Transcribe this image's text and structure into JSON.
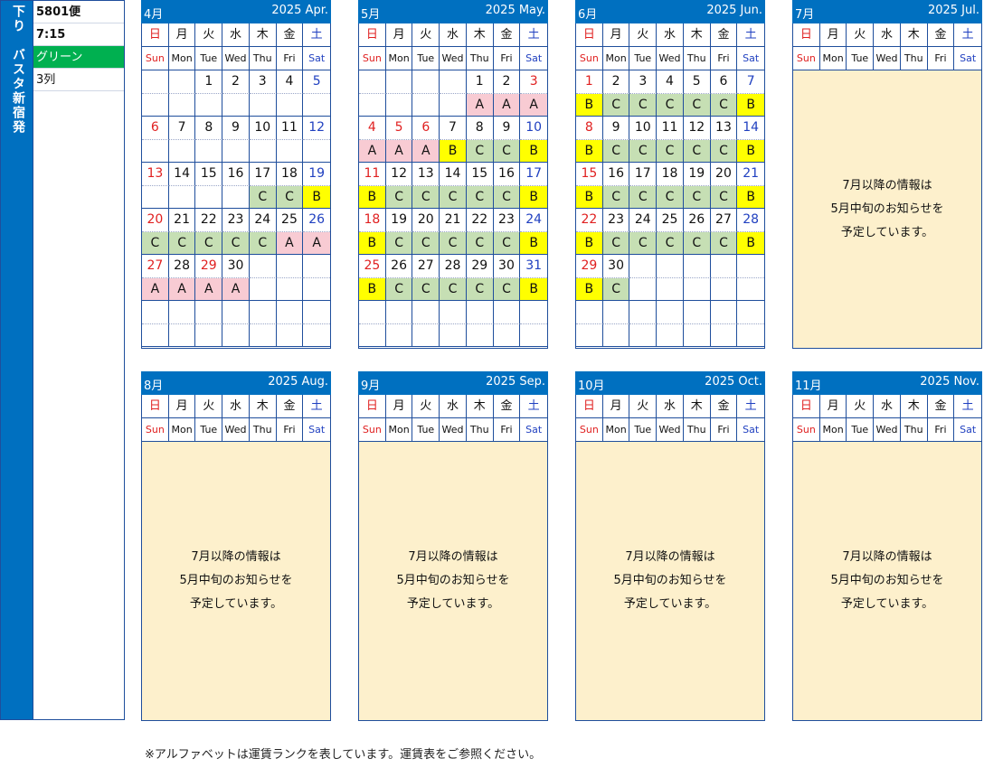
{
  "side": {
    "direction": "下り",
    "route": "バスタ新宿発"
  },
  "info": {
    "flight": "5801便",
    "time": "7:15",
    "seat_class": "グリーン",
    "rows": "3列"
  },
  "weekdays_jp": [
    "日",
    "月",
    "火",
    "水",
    "木",
    "金",
    "土"
  ],
  "weekdays_en": [
    "Sun",
    "Mon",
    "Tue",
    "Wed",
    "Thu",
    "Fri",
    "Sat"
  ],
  "colors": {
    "header": "#0070c0",
    "rankA": "#f8cbd3",
    "rankB": "#ffff00",
    "rankC": "#c6dfb4",
    "pending": "#fdf0cc",
    "green": "#00b050"
  },
  "months": [
    {
      "jp": "4月",
      "en": "2025 Apr.",
      "weeks": [
        {
          "days": [
            "",
            "",
            "1",
            "2",
            "3",
            "4",
            "5"
          ],
          "ranks": [
            "",
            "",
            "",
            "",
            "",
            "",
            ""
          ]
        },
        {
          "days": [
            "6",
            "7",
            "8",
            "9",
            "10",
            "11",
            "12"
          ],
          "ranks": [
            "",
            "",
            "",
            "",
            "",
            "",
            ""
          ]
        },
        {
          "days": [
            "13",
            "14",
            "15",
            "16",
            "17",
            "18",
            "19"
          ],
          "ranks": [
            "",
            "",
            "",
            "",
            "C",
            "C",
            "B"
          ]
        },
        {
          "days": [
            "20",
            "21",
            "22",
            "23",
            "24",
            "25",
            "26"
          ],
          "ranks": [
            "C",
            "C",
            "C",
            "C",
            "C",
            "A",
            "A"
          ]
        },
        {
          "days": [
            "27",
            "28",
            "29",
            "30",
            "",
            "",
            ""
          ],
          "ranks": [
            "A",
            "A",
            "A",
            "A",
            "",
            "",
            ""
          ],
          "red": [
            "29"
          ]
        },
        {
          "days": [
            "",
            "",
            "",
            "",
            "",
            "",
            ""
          ],
          "ranks": [
            "",
            "",
            "",
            "",
            "",
            "",
            ""
          ]
        }
      ]
    },
    {
      "jp": "5月",
      "en": "2025 May.",
      "weeks": [
        {
          "days": [
            "",
            "",
            "",
            "",
            "1",
            "2",
            "3"
          ],
          "ranks": [
            "",
            "",
            "",
            "",
            "A",
            "A",
            "A"
          ],
          "red": [
            "3"
          ]
        },
        {
          "days": [
            "4",
            "5",
            "6",
            "7",
            "8",
            "9",
            "10"
          ],
          "ranks": [
            "A",
            "A",
            "A",
            "B",
            "C",
            "C",
            "B"
          ],
          "red": [
            "5",
            "6"
          ]
        },
        {
          "days": [
            "11",
            "12",
            "13",
            "14",
            "15",
            "16",
            "17"
          ],
          "ranks": [
            "B",
            "C",
            "C",
            "C",
            "C",
            "C",
            "B"
          ]
        },
        {
          "days": [
            "18",
            "19",
            "20",
            "21",
            "22",
            "23",
            "24"
          ],
          "ranks": [
            "B",
            "C",
            "C",
            "C",
            "C",
            "C",
            "B"
          ]
        },
        {
          "days": [
            "25",
            "26",
            "27",
            "28",
            "29",
            "30",
            "31"
          ],
          "ranks": [
            "B",
            "C",
            "C",
            "C",
            "C",
            "C",
            "B"
          ]
        },
        {
          "days": [
            "",
            "",
            "",
            "",
            "",
            "",
            ""
          ],
          "ranks": [
            "",
            "",
            "",
            "",
            "",
            "",
            ""
          ]
        }
      ]
    },
    {
      "jp": "6月",
      "en": "2025 Jun.",
      "weeks": [
        {
          "days": [
            "1",
            "2",
            "3",
            "4",
            "5",
            "6",
            "7"
          ],
          "ranks": [
            "B",
            "C",
            "C",
            "C",
            "C",
            "C",
            "B"
          ]
        },
        {
          "days": [
            "8",
            "9",
            "10",
            "11",
            "12",
            "13",
            "14"
          ],
          "ranks": [
            "B",
            "C",
            "C",
            "C",
            "C",
            "C",
            "B"
          ]
        },
        {
          "days": [
            "15",
            "16",
            "17",
            "18",
            "19",
            "20",
            "21"
          ],
          "ranks": [
            "B",
            "C",
            "C",
            "C",
            "C",
            "C",
            "B"
          ]
        },
        {
          "days": [
            "22",
            "23",
            "24",
            "25",
            "26",
            "27",
            "28"
          ],
          "ranks": [
            "B",
            "C",
            "C",
            "C",
            "C",
            "C",
            "B"
          ]
        },
        {
          "days": [
            "29",
            "30",
            "",
            "",
            "",
            "",
            ""
          ],
          "ranks": [
            "B",
            "C",
            "",
            "",
            "",
            "",
            ""
          ]
        },
        {
          "days": [
            "",
            "",
            "",
            "",
            "",
            "",
            ""
          ],
          "ranks": [
            "",
            "",
            "",
            "",
            "",
            "",
            ""
          ]
        }
      ]
    },
    {
      "jp": "7月",
      "en": "2025 Jul.",
      "pending": true
    },
    {
      "jp": "8月",
      "en": "2025 Aug.",
      "pending": true
    },
    {
      "jp": "9月",
      "en": "2025 Sep.",
      "pending": true
    },
    {
      "jp": "10月",
      "en": "2025 Oct.",
      "pending": true
    },
    {
      "jp": "11月",
      "en": "2025 Nov.",
      "pending": true
    }
  ],
  "pending_message": [
    "7月以降の情報は",
    "5月中旬のお知らせを",
    "予定しています。"
  ],
  "footnote": "※アルファベットは運賃ランクを表しています。運賃表をご参照ください。"
}
